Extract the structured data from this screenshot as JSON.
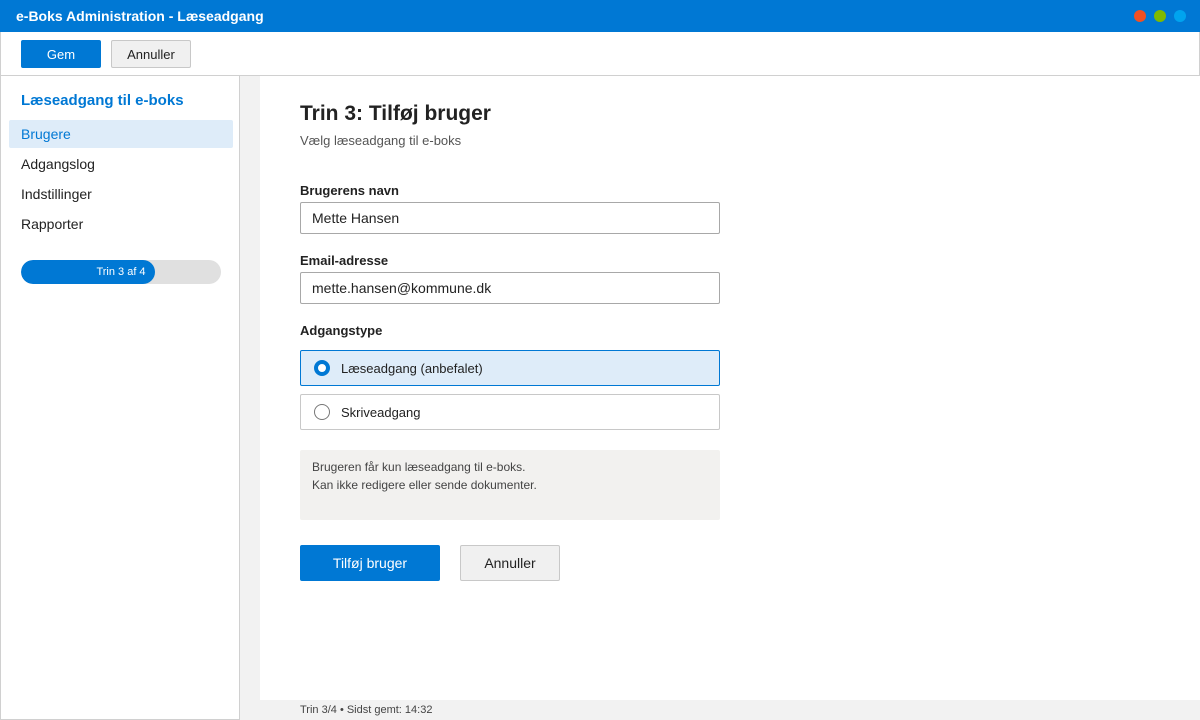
{
  "window": {
    "title": "e-Boks Administration - Læseadgang",
    "controls": [
      {
        "name": "close",
        "color": "#f25022"
      },
      {
        "name": "minimize",
        "color": "#7fba00"
      },
      {
        "name": "maximize",
        "color": "#00a4ef"
      }
    ]
  },
  "toolbar": {
    "save_label": "Gem",
    "cancel_label": "Annuller"
  },
  "sidebar": {
    "heading": "Læseadgang til e-boks",
    "items": [
      {
        "label": "Brugere",
        "active": true
      },
      {
        "label": "Adgangslog",
        "active": false
      },
      {
        "label": "Indstillinger",
        "active": false
      },
      {
        "label": "Rapporter",
        "active": false
      }
    ],
    "progress": {
      "label": "Trin 3 af 4",
      "step": 3,
      "total": 4
    }
  },
  "main": {
    "title": "Trin 3: Tilføj bruger",
    "subtitle": "Vælg læseadgang til e-boks",
    "name_field": {
      "label": "Brugerens navn",
      "value": "Mette Hansen"
    },
    "email_field": {
      "label": "Email-adresse",
      "value": "mette.hansen@kommune.dk"
    },
    "access_type": {
      "label": "Adgangstype",
      "options": [
        {
          "label": "Læseadgang (anbefalet)",
          "selected": true
        },
        {
          "label": "Skriveadgang",
          "selected": false
        }
      ]
    },
    "info": {
      "line1": "Brugeren får kun læseadgang til e-boks.",
      "line2": "Kan ikke redigere eller sende dokumenter."
    },
    "add_button_label": "Tilføj bruger",
    "cancel_button_label": "Annuller"
  },
  "status": {
    "text": "Trin 3/4 • Sidst gemt: 14:32"
  },
  "colors": {
    "accent": "#0078d4",
    "selected_bg": "#deecf9"
  }
}
